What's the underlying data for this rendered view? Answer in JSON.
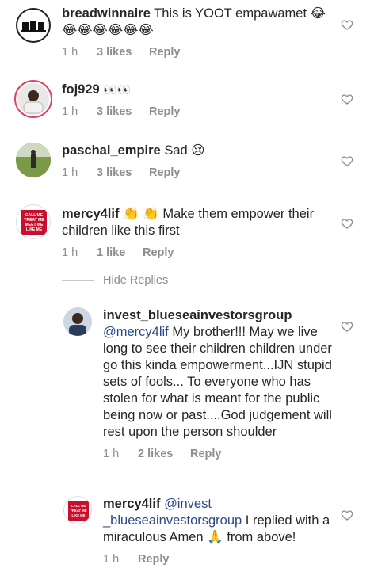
{
  "comments": [
    {
      "username": "breadwinnaire",
      "text": "This is YOOT empawamet",
      "emojis": "😂\n😂😂😂😂😂😂",
      "time": "1 h",
      "likes": "3 likes",
      "reply": "Reply"
    },
    {
      "username": "foj929",
      "text": "",
      "emojis": "👀👀",
      "time": "1 h",
      "likes": "3 likes",
      "reply": "Reply"
    },
    {
      "username": "paschal_empire",
      "text": "Sad",
      "emojis": "😢",
      "time": "1 h",
      "likes": "3 likes",
      "reply": "Reply"
    },
    {
      "username": "mercy4lif",
      "text": "👏 👏 Make them empower their children like this first",
      "emojis": "",
      "time": "1 h",
      "likes": "1 like",
      "reply": "Reply"
    }
  ],
  "hide_replies": "Hide Replies",
  "replies": [
    {
      "username": "invest_blueseainvestorsgroup",
      "mention": "@mercy4lif",
      "text": "My brother!!! May we live long to see their children children under go this kinda empowerment...IJN stupid sets of fools... To everyone who has stolen for what is meant for the public being now or past....God judgement will rest upon the person shoulder",
      "time": "1 h",
      "likes": "2 likes",
      "reply": "Reply"
    },
    {
      "username": "mercy4lif",
      "mention": "@invest _blueseainvestorsgroup",
      "text": "I replied with a miraculous Amen 🙏 from above!",
      "time": "1 h",
      "likes": "",
      "reply": "Reply"
    }
  ],
  "avatar_text": {
    "mercy": "CALL ME\nCHE ME\nTREAT ME\nMEET ME\nLIKE ME\nLOVE ME"
  }
}
